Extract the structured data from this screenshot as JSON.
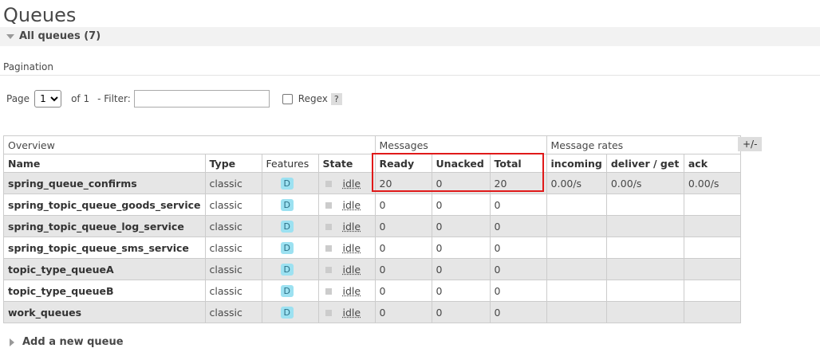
{
  "page": {
    "title": "Queues"
  },
  "section": {
    "label": "All queues (7)"
  },
  "pagination": {
    "heading": "Pagination",
    "page_label": "Page",
    "page_value": "1",
    "of_label": "of 1",
    "filter_label": "- Filter:",
    "filter_value": "",
    "regex_label": "Regex",
    "help_label": "?"
  },
  "table": {
    "groups": [
      "Overview",
      "Messages",
      "Message rates"
    ],
    "columns": [
      "Name",
      "Type",
      "Features",
      "State",
      "Ready",
      "Unacked",
      "Total",
      "incoming",
      "deliver / get",
      "ack"
    ],
    "toggle_label": "+/-",
    "rows": [
      {
        "name": "spring_queue_confirms",
        "type": "classic",
        "feature": "D",
        "state": "idle",
        "ready": "20",
        "unacked": "0",
        "total": "20",
        "incoming": "0.00/s",
        "deliver_get": "0.00/s",
        "ack": "0.00/s"
      },
      {
        "name": "spring_topic_queue_goods_service",
        "type": "classic",
        "feature": "D",
        "state": "idle",
        "ready": "0",
        "unacked": "0",
        "total": "0",
        "incoming": "",
        "deliver_get": "",
        "ack": ""
      },
      {
        "name": "spring_topic_queue_log_service",
        "type": "classic",
        "feature": "D",
        "state": "idle",
        "ready": "0",
        "unacked": "0",
        "total": "0",
        "incoming": "",
        "deliver_get": "",
        "ack": ""
      },
      {
        "name": "spring_topic_queue_sms_service",
        "type": "classic",
        "feature": "D",
        "state": "idle",
        "ready": "0",
        "unacked": "0",
        "total": "0",
        "incoming": "",
        "deliver_get": "",
        "ack": ""
      },
      {
        "name": "topic_type_queueA",
        "type": "classic",
        "feature": "D",
        "state": "idle",
        "ready": "0",
        "unacked": "0",
        "total": "0",
        "incoming": "",
        "deliver_get": "",
        "ack": ""
      },
      {
        "name": "topic_type_queueB",
        "type": "classic",
        "feature": "D",
        "state": "idle",
        "ready": "0",
        "unacked": "0",
        "total": "0",
        "incoming": "",
        "deliver_get": "",
        "ack": ""
      },
      {
        "name": "work_queues",
        "type": "classic",
        "feature": "D",
        "state": "idle",
        "ready": "0",
        "unacked": "0",
        "total": "0",
        "incoming": "",
        "deliver_get": "",
        "ack": ""
      }
    ]
  },
  "add_queue": {
    "label": "Add a new queue"
  },
  "colors": {
    "highlight": "#e01919",
    "badge": "#9ce1f1",
    "row_stripe": "#e6e6e6"
  }
}
